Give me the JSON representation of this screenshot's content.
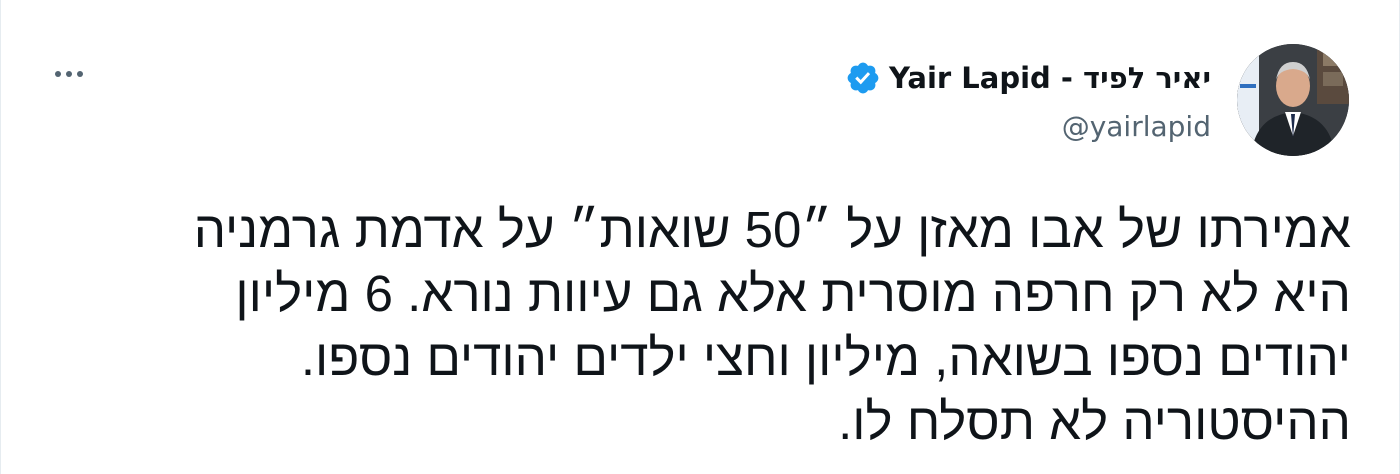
{
  "tweet": {
    "author": {
      "display_name": "יאיר לפיד - Yair Lapid",
      "handle": "@yairlapid",
      "verified": true,
      "avatar_icon": "avatar-photo",
      "verified_icon": "verified-badge-icon",
      "verified_color": "#1d9bf0"
    },
    "menu": {
      "icon": "more-options-icon"
    },
    "text_lines": [
      "אמירתו של אבו מאזן על ״50 שואות״ על אדמת גרמניה",
      "היא לא רק חרפה מוסרית אלא גם עיוות נורא. 6 מיליון",
      "יהודים נספו בשואה, מיליון וחצי ילדים יהודים נספו.",
      "ההיסטוריה לא תסלח לו."
    ]
  },
  "colors": {
    "text_primary": "#0f1419",
    "text_secondary": "#536471",
    "background": "#ffffff"
  }
}
